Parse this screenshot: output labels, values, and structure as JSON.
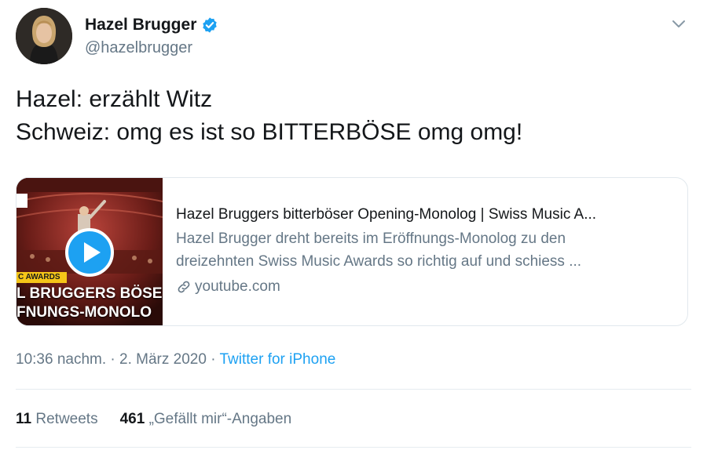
{
  "author": {
    "name": "Hazel Brugger",
    "handle": "@hazelbrugger",
    "verified": true
  },
  "icons": {
    "verified": "verified-badge-icon",
    "menu": "chevron-down-icon",
    "play": "play-icon",
    "link": "link-icon"
  },
  "tweet": {
    "lines": [
      "Hazel: erzählt Witz",
      "Schweiz: omg es ist so BITTERBÖSE omg omg!"
    ]
  },
  "card": {
    "title": "Hazel Bruggers bitterböser Opening-Monolog | Swiss Music A...",
    "description_lines": [
      "Hazel Brugger dreht bereits im Eröffnungs-Monolog zu den",
      "dreizehnten Swiss Music Awards so richtig auf und schiess ..."
    ],
    "domain": "youtube.com",
    "thumbnail": {
      "banner": "C AWARDS",
      "caption_lines": [
        "L BRUGGERS BÖSE",
        "FNUNGS-MONOLO"
      ]
    }
  },
  "meta": {
    "time": "10:36 nachm.",
    "separator": "·",
    "date": "2. März 2020",
    "source": "Twitter for iPhone"
  },
  "stats": {
    "retweets_count": "11",
    "retweets_label": "Retweets",
    "likes_count": "461",
    "likes_label": "„Gefällt mir“-Angaben"
  },
  "colors": {
    "accent": "#1da1f2",
    "text": "#14171a",
    "secondary": "#657786",
    "border": "#e1e8ed"
  }
}
